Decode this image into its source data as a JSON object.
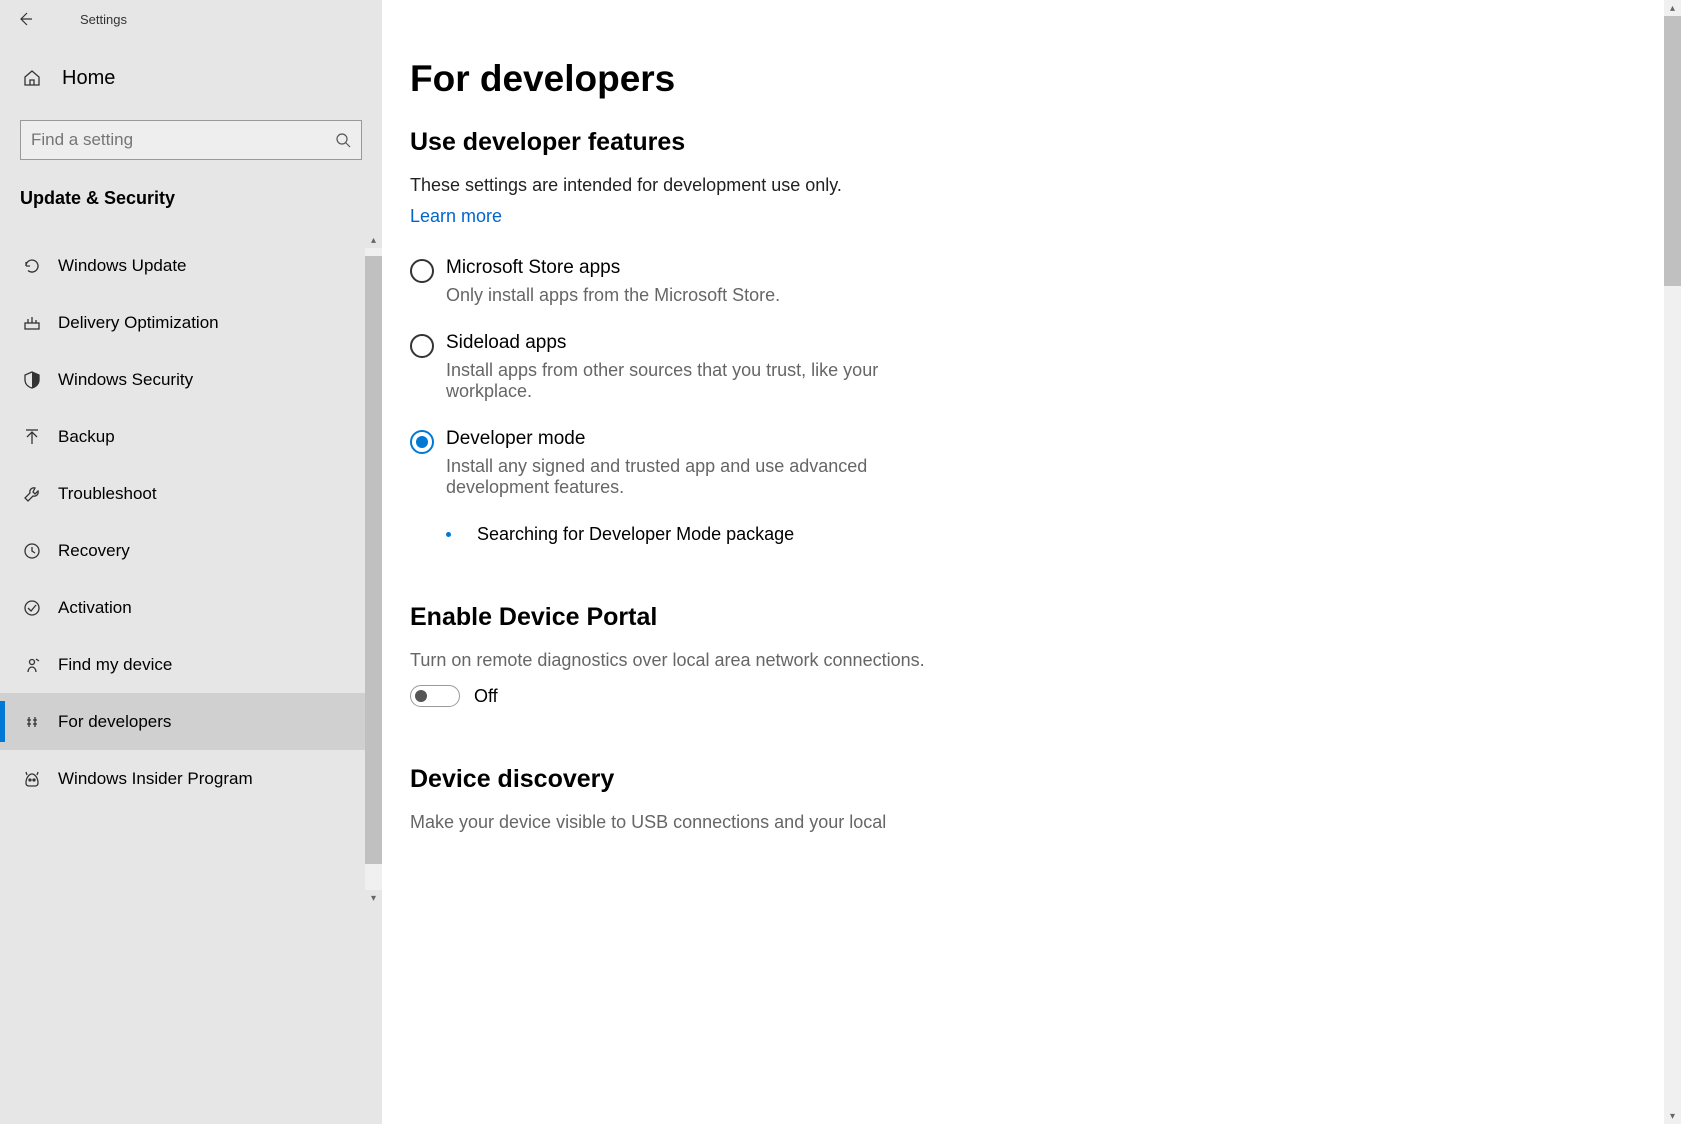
{
  "window": {
    "title": "Settings"
  },
  "sidebar": {
    "home_label": "Home",
    "search_placeholder": "Find a setting",
    "section": "Update & Security",
    "items": [
      {
        "icon": "refresh",
        "label": "Windows Update"
      },
      {
        "icon": "delivery",
        "label": "Delivery Optimization"
      },
      {
        "icon": "shield",
        "label": "Windows Security"
      },
      {
        "icon": "backup",
        "label": "Backup"
      },
      {
        "icon": "wrench",
        "label": "Troubleshoot"
      },
      {
        "icon": "recovery",
        "label": "Recovery"
      },
      {
        "icon": "activation",
        "label": "Activation"
      },
      {
        "icon": "find",
        "label": "Find my device"
      },
      {
        "icon": "developers",
        "label": "For developers"
      },
      {
        "icon": "insider",
        "label": "Windows Insider Program"
      }
    ],
    "selected_index": 8
  },
  "main": {
    "title": "For developers",
    "section1": {
      "heading": "Use developer features",
      "description": "These settings are intended for development use only.",
      "learn_more": "Learn more",
      "options": [
        {
          "title": "Microsoft Store apps",
          "desc": "Only install apps from the Microsoft Store.",
          "selected": false
        },
        {
          "title": "Sideload apps",
          "desc": "Install apps from other sources that you trust, like your workplace.",
          "selected": false
        },
        {
          "title": "Developer mode",
          "desc": "Install any signed and trusted app and use advanced development features.",
          "selected": true
        }
      ],
      "status": "Searching for Developer Mode package"
    },
    "section2": {
      "heading": "Enable Device Portal",
      "description": "Turn on remote diagnostics over local area network connections.",
      "toggle_state": "Off"
    },
    "section3": {
      "heading": "Device discovery",
      "description": "Make your device visible to USB connections and your local"
    }
  }
}
